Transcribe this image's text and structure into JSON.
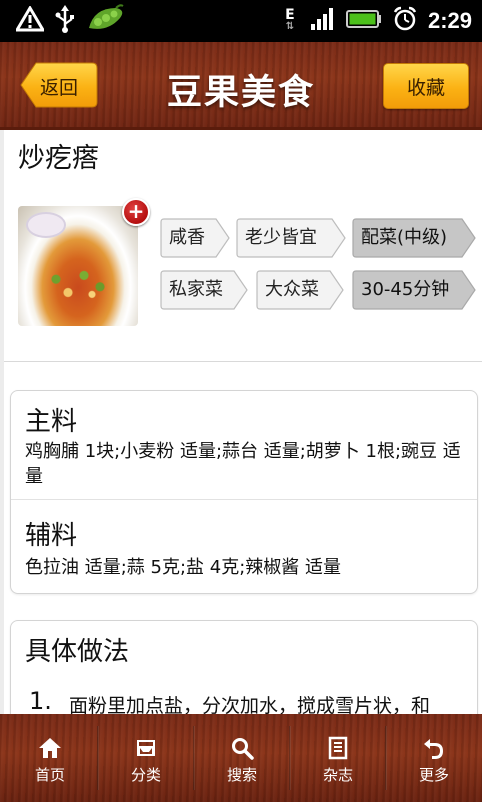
{
  "status_bar": {
    "time": "2:29",
    "network": "E",
    "icons": [
      "warning-icon",
      "usb-icon",
      "pea-pod-icon",
      "data-arrows-icon",
      "signal-icon",
      "battery-icon",
      "alarm-icon"
    ]
  },
  "header": {
    "back_label": "返回",
    "title": "豆果美食",
    "favorite_label": "收藏"
  },
  "recipe": {
    "name": "炒疙瘩",
    "image_icon": "dish-photo",
    "tags_row1": [
      "咸香",
      "老少皆宜",
      "配菜(中级)"
    ],
    "tags_row2": [
      "私家菜",
      "大众菜",
      "30-45分钟"
    ]
  },
  "ingredients": {
    "main_title": "主料",
    "main_text": "鸡胸脯 1块;小麦粉 适量;蒜台 适量;胡萝卜 1根;豌豆 适量",
    "aux_title": "辅料",
    "aux_text": "色拉油 适量;蒜 5克;盐 4克;辣椒酱 适量"
  },
  "method": {
    "title": "具体做法",
    "step_number": "1.",
    "step_text": "面粉里加点盐，分次加水，搅成雪片状，和"
  },
  "bottom_nav": [
    {
      "label": "首页",
      "icon": "home-icon"
    },
    {
      "label": "分类",
      "icon": "category-icon"
    },
    {
      "label": "搜索",
      "icon": "search-icon"
    },
    {
      "label": "杂志",
      "icon": "magazine-icon"
    },
    {
      "label": "更多",
      "icon": "more-icon"
    }
  ],
  "colors": {
    "wood": "#7a2a16",
    "button_orange": "#fbb214",
    "tag_light": "#f2f2f2",
    "tag_dark": "#c4c4c4"
  }
}
